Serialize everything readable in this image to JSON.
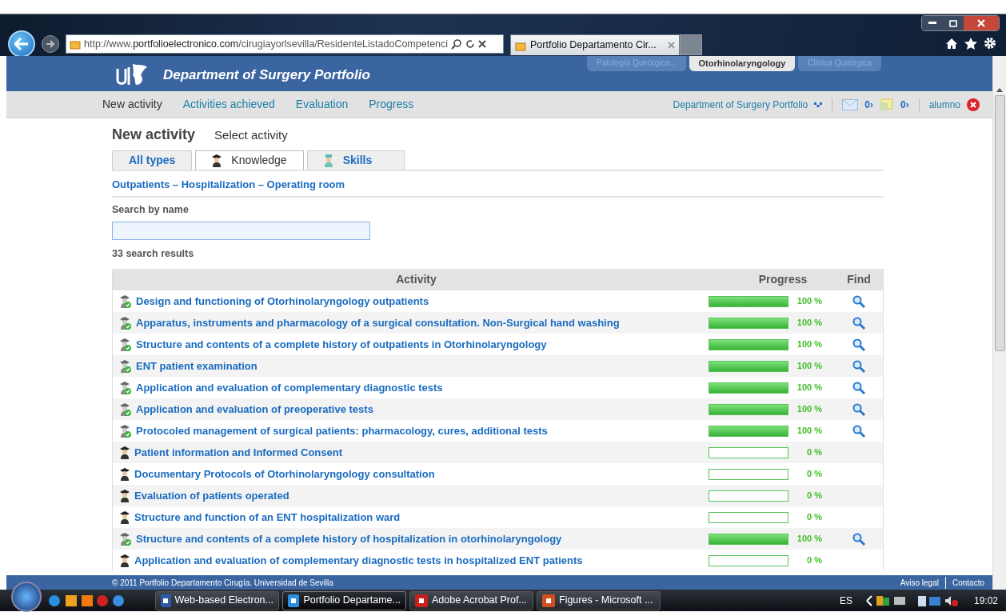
{
  "browser": {
    "url": "http://www.**portfolioelectronico.com**/cirugiayorlsevilla/ResidenteListadoCompetenci",
    "tabs": [
      {
        "title": "Portfolio Departamento Cir...",
        "selected": true
      }
    ]
  },
  "site": {
    "title": "Department of Surgery Portfolio",
    "subject_tabs": [
      {
        "label": "Patología Quirúrgica...",
        "selected": false
      },
      {
        "label": "Otorhinolaryngology",
        "selected": true
      },
      {
        "label": "Clínica Quirúrgica",
        "selected": false
      }
    ],
    "nav": [
      {
        "label": "New activity",
        "selected": true
      },
      {
        "label": "Activities achieved",
        "selected": false
      },
      {
        "label": "Evaluation",
        "selected": false
      },
      {
        "label": "Progress",
        "selected": false
      }
    ],
    "portal": "Department of Surgery Portfolio",
    "mail_count": "0›",
    "notes_count": "0›",
    "user": "alumno"
  },
  "page": {
    "heading": "New activity",
    "subheading": "Select activity",
    "type_tabs": [
      {
        "label": "All types",
        "kind": "all",
        "selected": false
      },
      {
        "label": "Knowledge",
        "kind": "knowledge",
        "selected": true
      },
      {
        "label": "Skills",
        "kind": "skills",
        "selected": false
      }
    ],
    "areas": "Outpatients – Hospitalization – Operating room",
    "search_label": "Search by name",
    "results": "33 search results",
    "columns": [
      "Activity",
      "Progress",
      "Find"
    ],
    "rows": [
      {
        "title": "Design and functioning of Otorhinolaryngology outpatients",
        "completed": true,
        "level": 1,
        "reading": "100 %"
      },
      {
        "title": "Apparatus, instruments and pharmacology of a surgical consultation. Non-Surgical hand washing",
        "completed": true,
        "level": 1,
        "reading": "100 %"
      },
      {
        "title": "Structure and contents of a complete history of outpatients in Otorhinolaryngology",
        "completed": true,
        "level": 1,
        "reading": "100 %"
      },
      {
        "title": "ENT patient examination",
        "completed": true,
        "level": 1,
        "reading": "100 %"
      },
      {
        "title": "Application and evaluation of complementary diagnostic tests",
        "completed": true,
        "level": 1,
        "reading": "100 %"
      },
      {
        "title": "Application and evaluation of preoperative tests",
        "completed": true,
        "level": 1,
        "reading": "100 %"
      },
      {
        "title": "Protocoled management of surgical patients: pharmacology, cures, additional tests",
        "completed": true,
        "level": 1,
        "reading": "100 %"
      },
      {
        "title": "Patient information and Informed Consent",
        "completed": false,
        "level": 0,
        "reading": "0 %"
      },
      {
        "title": "Documentary Protocols of Otorhinolaryngology consultation",
        "completed": false,
        "level": 0,
        "reading": "0 %"
      },
      {
        "title": "Evaluation of patients operated",
        "completed": false,
        "level": 0,
        "reading": "0 %"
      },
      {
        "title": "Structure and function of an ENT hospitalization ward",
        "completed": false,
        "level": 0,
        "reading": "0 %"
      },
      {
        "title": "Structure and contents of a complete history of hospitalization in otorhinolaryngology",
        "completed": true,
        "level": 1,
        "reading": "100 %"
      },
      {
        "title": "Application and evaluation of complementary diagnostic tests in hospitalized ENT patients",
        "completed": false,
        "level": 0,
        "reading": "0 %"
      }
    ]
  },
  "footer": {
    "copyright": "© 2011 Portfolio Departamento Cirugía. Universidad de Sevilla",
    "links": [
      "Aviso legal",
      "Contacto"
    ]
  },
  "taskbar": {
    "buttons": [
      {
        "label": "Web-based Electron...",
        "kind": "word",
        "selected": false
      },
      {
        "label": "Portfolio Departame...",
        "kind": "ie",
        "selected": true
      },
      {
        "label": "Adobe Acrobat Prof...",
        "kind": "pdf",
        "selected": false
      },
      {
        "label": "Figures - Microsoft ...",
        "kind": "ppt",
        "selected": false
      }
    ],
    "language": "ES",
    "clock": "19:02"
  }
}
